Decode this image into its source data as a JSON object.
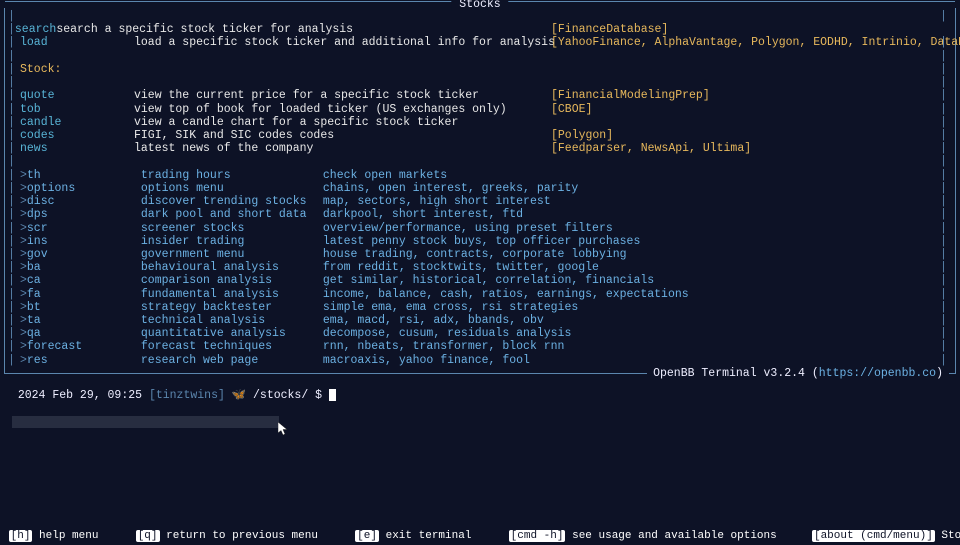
{
  "panel": {
    "title": "Stocks",
    "footer_label": "OpenBB Terminal",
    "footer_version": "v3.2.4",
    "footer_url": "https://openbb.co"
  },
  "top_rows": [
    {
      "cmd": "search",
      "desc": "search a specific stock ticker for analysis",
      "prov": "[FinanceDatabase]"
    },
    {
      "cmd": "load",
      "desc": "load a specific stock ticker and additional info for analysis",
      "prov": "[YahooFinance, AlphaVantage, Polygon, EODHD, Intrinio, DataBento]"
    }
  ],
  "section_label": "Stock:",
  "stock_rows": [
    {
      "cmd": "quote",
      "desc": "view the current price for a specific stock ticker",
      "prov": "[FinancialModelingPrep]"
    },
    {
      "cmd": "tob",
      "desc": "view top of book for loaded ticker (US exchanges only)",
      "prov": "[CBOE]"
    },
    {
      "cmd": "candle",
      "desc": "view a candle chart for a specific stock ticker",
      "prov": ""
    },
    {
      "cmd": "codes",
      "desc": "FIGI, SIK and SIC codes codes",
      "prov": "[Polygon]"
    },
    {
      "cmd": "news",
      "desc": "latest news of the company",
      "prov": "[Feedparser, NewsApi, Ultima]"
    }
  ],
  "menu_rows": [
    {
      "cmd": "th",
      "name": "trading hours",
      "desc": "check open markets"
    },
    {
      "cmd": "options",
      "name": "options menu",
      "desc": "chains, open interest, greeks, parity"
    },
    {
      "cmd": "disc",
      "name": "discover trending stocks",
      "desc": "map, sectors, high short interest"
    },
    {
      "cmd": "dps",
      "name": "dark pool and short data",
      "desc": "darkpool, short interest, ftd"
    },
    {
      "cmd": "scr",
      "name": "screener stocks",
      "desc": "overview/performance, using preset filters"
    },
    {
      "cmd": "ins",
      "name": "insider trading",
      "desc": "latest penny stock buys, top officer purchases"
    },
    {
      "cmd": "gov",
      "name": "government menu",
      "desc": "house trading, contracts, corporate lobbying"
    },
    {
      "cmd": "ba",
      "name": "behavioural analysis",
      "desc": "from reddit, stocktwits, twitter, google"
    },
    {
      "cmd": "ca",
      "name": "comparison analysis",
      "desc": "get similar, historical, correlation, financials"
    },
    {
      "cmd": "fa",
      "name": "fundamental analysis",
      "desc": "income, balance, cash, ratios, earnings, expectations"
    },
    {
      "cmd": "bt",
      "name": "strategy backtester",
      "desc": "simple ema, ema cross, rsi strategies"
    },
    {
      "cmd": "ta",
      "name": "technical analysis",
      "desc": "ema, macd, rsi, adx, bbands, obv"
    },
    {
      "cmd": "qa",
      "name": "quantitative analysis",
      "desc": "decompose, cusum, residuals analysis"
    },
    {
      "cmd": "forecast",
      "name": "forecast techniques",
      "desc": "rnn, nbeats, transformer, block rnn"
    },
    {
      "cmd": "res",
      "name": "research web page",
      "desc": "macroaxis, yahoo finance, fool"
    }
  ],
  "prompt": {
    "timestamp": "2024 Feb 29, 09:25",
    "host": "[tinztwins]",
    "icon": "🦋",
    "path": "/stocks/",
    "prompt_char": "$"
  },
  "bottom": {
    "h_key": "h",
    "h_label": "help menu",
    "q_key": "q",
    "q_label": "return to previous menu",
    "e_key": "e",
    "e_label": "exit terminal",
    "cmd_key": "cmd -h",
    "cmd_label": "see usage and available options",
    "about_key": "about (cmd/menu)",
    "rest": "Stocks (cmd/menu) Documen"
  }
}
